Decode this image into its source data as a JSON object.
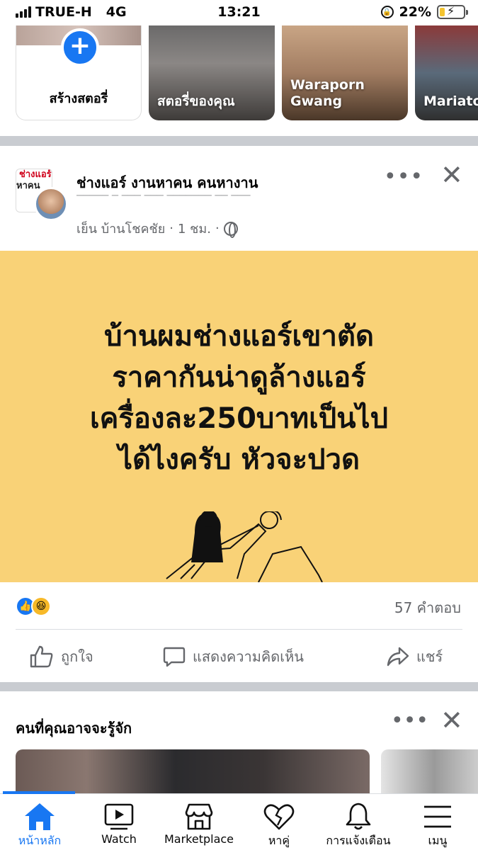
{
  "status_bar": {
    "carrier": "TRUE-H",
    "network": "4G",
    "time": "13:21",
    "battery": "22%",
    "battery_level": 0.22
  },
  "stories": {
    "create_label": "สร้างสตอรี่",
    "items": [
      {
        "name": "สตอรี่ของคุณ"
      },
      {
        "name": "Waraporn\nGwang"
      },
      {
        "name": "Mariato"
      }
    ]
  },
  "post": {
    "page_name": "ช่างแอร์ งานหาคน คนหางาน",
    "author": "เย็น บ้านโชคชัย",
    "time": "1 ชม.",
    "separator": "·",
    "avatar_text_1": "ช่างแอร์",
    "avatar_text_2": "หาคน",
    "image_text_lines": [
      "บ้านผมช่างแอร์เขาตัด",
      "ราคากันน่าดูล้างแอร์",
      "เครื่องละ250บาทเป็นไป",
      "ได้ไงครับ หัวจะปวด"
    ],
    "image_bg": "#f9d277",
    "comments": "57 คำตอบ",
    "actions": {
      "like": "ถูกใจ",
      "comment": "แสดงความคิดเห็น",
      "share": "แชร์"
    }
  },
  "pymk": {
    "title": "คนที่คุณอาจจะรู้จัก"
  },
  "tabbar": {
    "accent": "#1877f2",
    "tabs": [
      {
        "label": "หน้าหลัก",
        "icon": "home-icon",
        "active": true
      },
      {
        "label": "Watch",
        "icon": "watch-icon",
        "active": false
      },
      {
        "label": "Marketplace",
        "icon": "marketplace-icon",
        "active": false
      },
      {
        "label": "หาคู่",
        "icon": "dating-heart-icon",
        "active": false
      },
      {
        "label": "การแจ้งเตือน",
        "icon": "bell-icon",
        "active": false
      },
      {
        "label": "เมนู",
        "icon": "menu-icon",
        "active": false
      }
    ]
  }
}
